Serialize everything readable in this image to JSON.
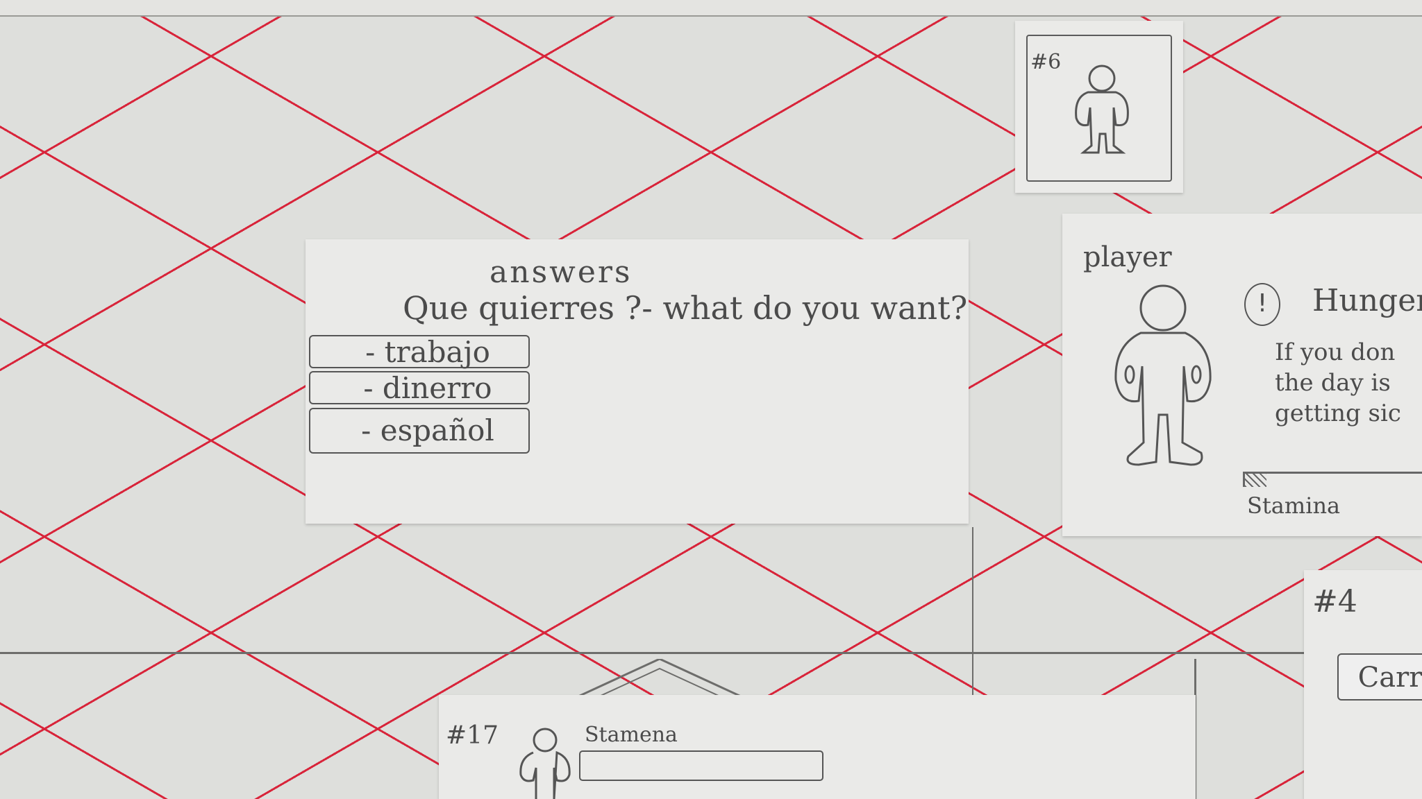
{
  "answers_card": {
    "title": "answers",
    "question": "Que quierres ?- what do you want?",
    "options": [
      "- trabajo",
      "- dinerro",
      "- español"
    ]
  },
  "card_6": {
    "number": "#6"
  },
  "player_card": {
    "label": "player",
    "alert_symbol": "!",
    "hunger_title": "Hunger",
    "hunger_description": "If you don\nthe day is\ngetting sic",
    "stamina_label": "Stamina",
    "stamina_level": 0.12
  },
  "card_4": {
    "number": "#4",
    "button_label": "Carr"
  },
  "card_17": {
    "number": "#17",
    "stamina_label": "Stamena"
  },
  "colors": {
    "grid_line": "#d8243a",
    "paper": "#eaeae8",
    "pencil": "#4b4b4b"
  }
}
